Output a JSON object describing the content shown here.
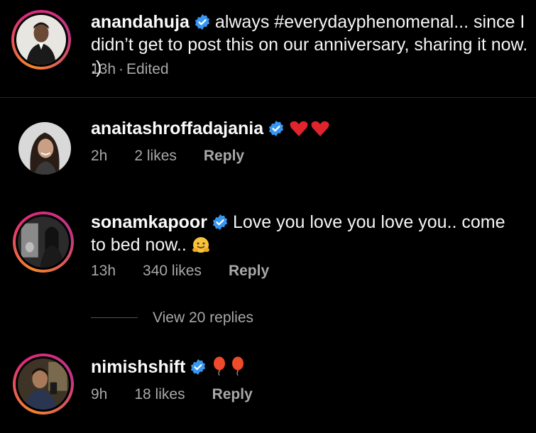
{
  "post": {
    "username": "anandahuja",
    "caption": "always #everydayphenomenal... since I didn’t get to post this on our anniversary, sharing it now. :)",
    "time": "13h",
    "separator": "·",
    "edited": "Edited"
  },
  "comments": [
    {
      "username": "anaitashroffadajania",
      "text": "",
      "emoji": "red-hearts",
      "time": "2h",
      "likes": "2 likes",
      "reply": "Reply"
    },
    {
      "username": "sonamkapoor",
      "text": "Love you love you love you.. come to bed now..",
      "emoji": "hugging-face",
      "time": "13h",
      "likes": "340 likes",
      "reply": "Reply",
      "view_replies": "View 20 replies"
    },
    {
      "username": "nimishshift",
      "text": "",
      "emoji": "balloons",
      "time": "9h",
      "likes": "18 likes",
      "reply": "Reply"
    }
  ],
  "colors": {
    "background": "#000000",
    "verified": "#3897f0",
    "secondary_text": "#a8a8a8",
    "story_ring": "#dd2a7b"
  }
}
